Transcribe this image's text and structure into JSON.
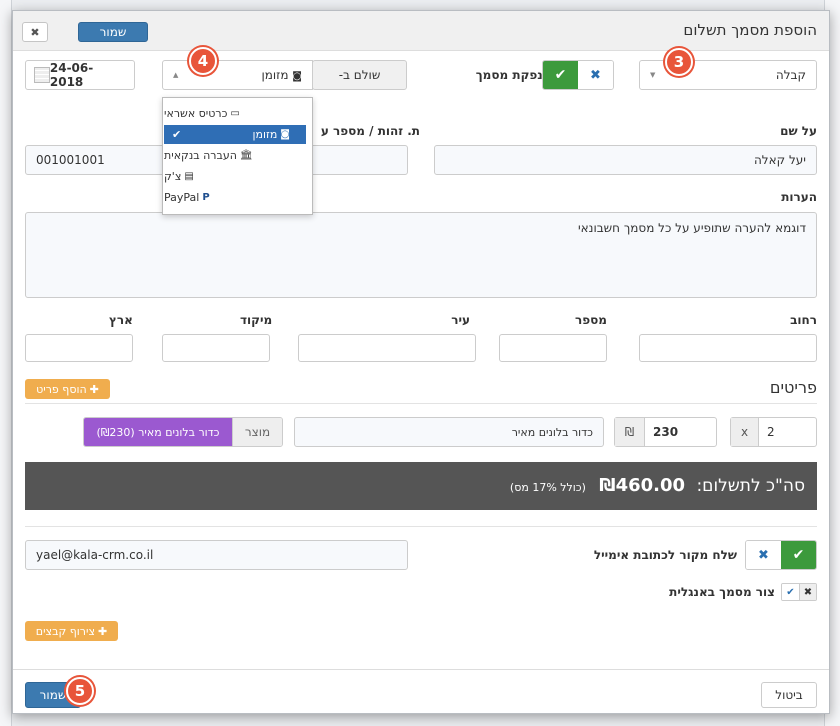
{
  "dialog": {
    "title": "הוספת מסמך תשלום",
    "save_top": "שמור",
    "close_glyph": "✖"
  },
  "doc_type": {
    "value": "קבלה"
  },
  "issue_doc": {
    "label": "הנפקת מסמך",
    "check": "✔",
    "cross": "✖"
  },
  "paid_by": {
    "label": "שולם ב-",
    "selected": "מזומן",
    "options": [
      {
        "label": "כרטיס אשראי",
        "icon": "credit-card-icon",
        "glyph": "▭"
      },
      {
        "label": "מזומן",
        "icon": "cash-icon",
        "glyph": "◙"
      },
      {
        "label": "העברה בנקאית",
        "icon": "bank-icon",
        "glyph": "🏛"
      },
      {
        "label": "צ'ק",
        "icon": "check-icon",
        "glyph": "▤"
      },
      {
        "label": "PayPal",
        "icon": "paypal-icon",
        "glyph": "P"
      }
    ],
    "check_glyph": "✔"
  },
  "date": {
    "value": "24-06-2018"
  },
  "name": {
    "label": "על שם",
    "value": "יעל קאלה"
  },
  "tax_id": {
    "label": "ת. זהות / מספר ע",
    "value": "001001001"
  },
  "notes": {
    "label": "הערות",
    "value": "דוגמא להערה שתופיע על כל מסמך חשבונאי"
  },
  "address": {
    "street": "רחוב",
    "number": "מספר",
    "city": "עיר",
    "zip": "מיקוד",
    "country": "ארץ"
  },
  "items": {
    "heading": "פריטים",
    "add_label": "הוסף פריט",
    "plus": "✚",
    "row": {
      "qty": "2",
      "x": "x",
      "price": "230",
      "currency": "₪",
      "description": "כדור בלונים מאיר",
      "product_label": "מוצר",
      "product_tag": "כדור בלונים מאיר (₪230)"
    }
  },
  "total": {
    "prefix": "סה\"כ לתשלום:",
    "amount": "₪460.00",
    "vat": "(כולל 17% מס)"
  },
  "email": {
    "label": "שלח מקור לכתובת אימייל",
    "value": "yael@kala-crm.co.il"
  },
  "english": {
    "label": "צור מסמך באנגלית"
  },
  "attach": {
    "label": "צירוף קבצים"
  },
  "footer": {
    "save": "שמור",
    "cancel": "ביטול"
  },
  "steps": [
    "3",
    "4",
    "5"
  ],
  "colors": {
    "primary": "#3c7ab0",
    "success": "#3c9a3c",
    "warning": "#f0ad4e",
    "product_tag": "#9b59d0",
    "step_badge": "#e8553a"
  }
}
